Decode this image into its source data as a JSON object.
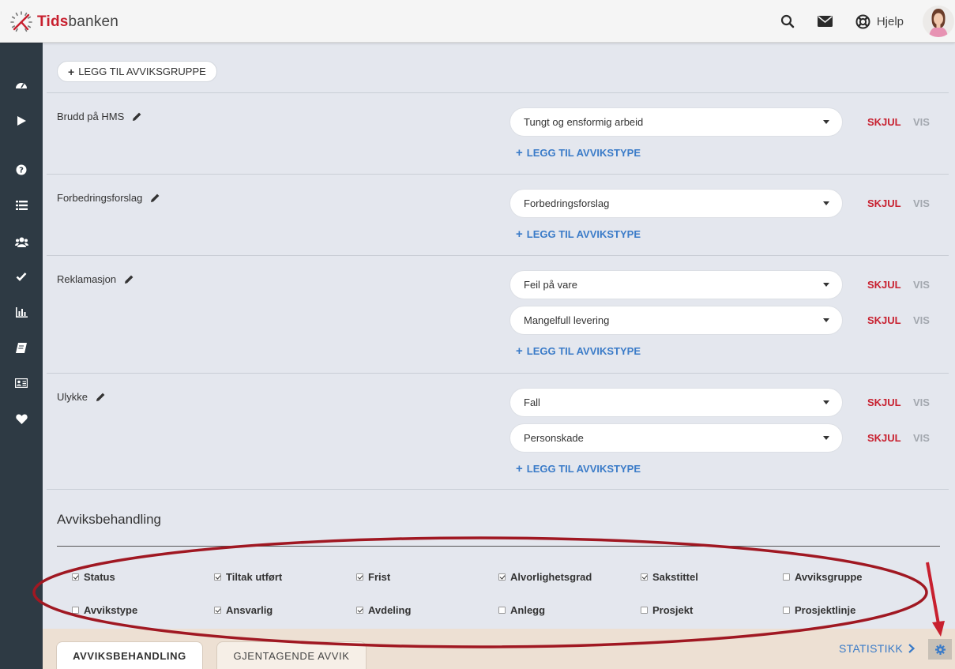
{
  "brand": {
    "part1": "Tids",
    "part2": "banken"
  },
  "header": {
    "help_label": "Hjelp"
  },
  "sidebar": {
    "icons": [
      "dashboard-icon",
      "play-icon",
      "question-icon",
      "list-icon",
      "users-icon",
      "check-icon",
      "bar-chart-icon",
      "book-icon",
      "id-card-icon",
      "heart-icon"
    ]
  },
  "add_group_label": "LEGG TIL AVVIKSGRUPPE",
  "add_type_label": "LEGG TIL AVVIKSTYPE",
  "hide_label": "SKJUL",
  "show_label": "VIS",
  "groups": [
    {
      "name": "Brudd på HMS",
      "types": [
        "Tungt og ensformig arbeid"
      ]
    },
    {
      "name": "Forbedringsforslag",
      "types": [
        "Forbedringsforslag"
      ]
    },
    {
      "name": "Reklamasjon",
      "types": [
        "Feil på vare",
        "Mangelfull levering"
      ]
    },
    {
      "name": "Ulykke",
      "types": [
        "Fall",
        "Personskade"
      ]
    }
  ],
  "handling": {
    "title": "Avviksbehandling",
    "fields": [
      {
        "label": "Status",
        "checked": true
      },
      {
        "label": "Tiltak utført",
        "checked": true
      },
      {
        "label": "Frist",
        "checked": true
      },
      {
        "label": "Alvorlighetsgrad",
        "checked": true
      },
      {
        "label": "Sakstittel",
        "checked": true
      },
      {
        "label": "Avviksgruppe",
        "checked": false
      },
      {
        "label": "Avvikstype",
        "checked": false
      },
      {
        "label": "Ansvarlig",
        "checked": true
      },
      {
        "label": "Avdeling",
        "checked": true
      },
      {
        "label": "Anlegg",
        "checked": false
      },
      {
        "label": "Prosjekt",
        "checked": false
      },
      {
        "label": "Prosjektlinje",
        "checked": false
      }
    ]
  },
  "tabs": [
    "AVVIKSBEHANDLING",
    "GJENTAGENDE AVVIK"
  ],
  "statistics_label": "STATISTIKK",
  "colors": {
    "accent_red": "#c8202f",
    "link_blue": "#3a7bc8",
    "sidebar": "#2e3a44",
    "annotation": "#a01822"
  }
}
